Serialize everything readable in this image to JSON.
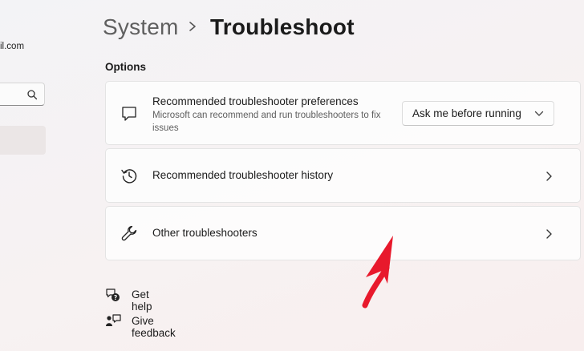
{
  "sidebar": {
    "account_email_fragment": "il.com",
    "search_icon": "search-icon"
  },
  "header": {
    "breadcrumb_parent": "System",
    "breadcrumb_current": "Troubleshoot",
    "separator_icon": "chevron-right-icon"
  },
  "options": {
    "section_title": "Options",
    "cards": [
      {
        "icon": "chat-bubble-icon",
        "title": "Recommended troubleshooter preferences",
        "description": "Microsoft can recommend and run troubleshooters to fix issues",
        "dropdown_value": "Ask me before running"
      },
      {
        "icon": "history-icon",
        "title": "Recommended troubleshooter history"
      },
      {
        "icon": "wrench-icon",
        "title": "Other troubleshooters"
      }
    ]
  },
  "links": {
    "get_help": "Get help",
    "give_feedback": "Give feedback"
  },
  "annotation": {
    "arrow_color": "#e8192c"
  },
  "colors": {
    "text_primary": "#1b1b1b",
    "text_secondary": "#5e5e5e",
    "selected_nav": "#ebe6e6"
  }
}
